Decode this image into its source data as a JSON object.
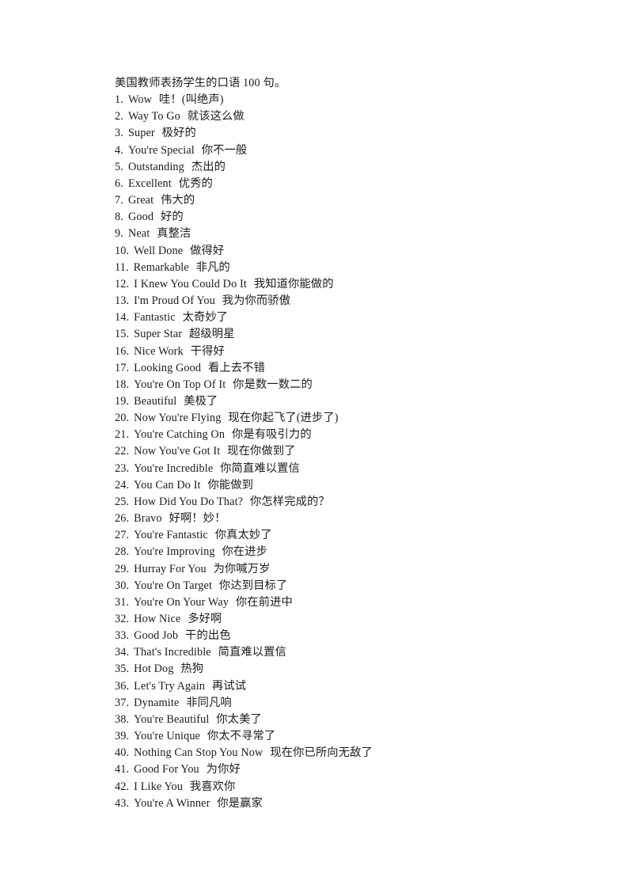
{
  "document": {
    "title": "美国教师表扬学生的口语 100 句。",
    "lines": [
      {
        "num": "1.",
        "en": "Wow",
        "zh": "哇！(叫绝声)"
      },
      {
        "num": "2.",
        "en": "Way To Go",
        "zh": "就该这么做"
      },
      {
        "num": "3.",
        "en": "Super",
        "zh": "极好的"
      },
      {
        "num": "4.",
        "en": "You're Special",
        "zh": "你不一般"
      },
      {
        "num": "5.",
        "en": "Outstanding",
        "zh": "杰出的"
      },
      {
        "num": "6.",
        "en": "Excellent",
        "zh": "优秀的"
      },
      {
        "num": "7.",
        "en": "Great",
        "zh": "伟大的"
      },
      {
        "num": "8.",
        "en": "Good",
        "zh": "好的"
      },
      {
        "num": "9.",
        "en": "Neat",
        "zh": "真整洁"
      },
      {
        "num": "10.",
        "en": "Well Done",
        "zh": "做得好"
      },
      {
        "num": "11.",
        "en": "Remarkable",
        "zh": "非凡的"
      },
      {
        "num": "12.",
        "en": "I Knew You Could Do It",
        "zh": "我知道你能做的"
      },
      {
        "num": "13.",
        "en": "I'm Proud Of You",
        "zh": "我为你而骄傲"
      },
      {
        "num": "14.",
        "en": "Fantastic",
        "zh": "太奇妙了"
      },
      {
        "num": "15.",
        "en": "Super Star",
        "zh": "超级明星"
      },
      {
        "num": "16.",
        "en": "Nice Work",
        "zh": "干得好"
      },
      {
        "num": "17.",
        "en": "Looking Good",
        "zh": "看上去不错"
      },
      {
        "num": "18.",
        "en": "You're On Top Of It",
        "zh": "你是数一数二的"
      },
      {
        "num": "19.",
        "en": "Beautiful",
        "zh": "美极了"
      },
      {
        "num": "20.",
        "en": "Now You're Flying",
        "zh": "现在你起飞了(进步了)"
      },
      {
        "num": "21.",
        "en": "You're Catching On",
        "zh": "你是有吸引力的"
      },
      {
        "num": "22.",
        "en": "Now You've Got It",
        "zh": "现在你做到了"
      },
      {
        "num": "23.",
        "en": "You're Incredible",
        "zh": "你简直难以置信"
      },
      {
        "num": "24.",
        "en": "You Can Do It",
        "zh": "你能做到"
      },
      {
        "num": "25.",
        "en": "How Did You Do That?",
        "zh": "你怎样完成的？"
      },
      {
        "num": "26.",
        "en": "Bravo",
        "zh": "好啊！妙！"
      },
      {
        "num": "27.",
        "en": "You're Fantastic",
        "zh": "你真太妙了"
      },
      {
        "num": "28.",
        "en": "You're Improving",
        "zh": "你在进步"
      },
      {
        "num": "29.",
        "en": "Hurray For You",
        "zh": "为你喊万岁"
      },
      {
        "num": "30.",
        "en": "You're On Target",
        "zh": "你达到目标了"
      },
      {
        "num": "31.",
        "en": "You're On Your Way",
        "zh": "你在前进中"
      },
      {
        "num": "32.",
        "en": "How Nice",
        "zh": "多好啊"
      },
      {
        "num": "33.",
        "en": "Good Job",
        "zh": "干的出色"
      },
      {
        "num": "34.",
        "en": "That's Incredible",
        "zh": "简直难以置信"
      },
      {
        "num": "35.",
        "en": "Hot Dog",
        "zh": "热狗"
      },
      {
        "num": "36.",
        "en": "Let's Try Again",
        "zh": "再试试"
      },
      {
        "num": "37.",
        "en": "Dynamite",
        "zh": "非同凡响"
      },
      {
        "num": "38.",
        "en": "You're Beautiful",
        "zh": "你太美了"
      },
      {
        "num": "39.",
        "en": "You're Unique",
        "zh": "你太不寻常了"
      },
      {
        "num": "40.",
        "en": "Nothing Can Stop You Now",
        "zh": "现在你已所向无敌了"
      },
      {
        "num": "41.",
        "en": "Good For You",
        "zh": "为你好"
      },
      {
        "num": "42.",
        "en": "I Like You",
        "zh": "我喜欢你"
      },
      {
        "num": "43.",
        "en": "You're A Winner",
        "zh": "你是赢家"
      }
    ]
  },
  "colors": {
    "page_background": "#ffffff",
    "text": "#1c1c1c"
  }
}
